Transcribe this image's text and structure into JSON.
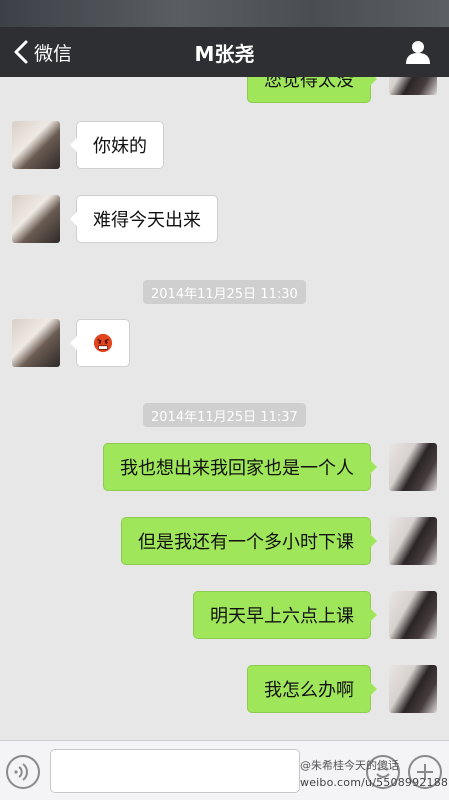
{
  "nav": {
    "back_label": "微信",
    "title": "M张尧"
  },
  "messages": [
    {
      "side": "right",
      "text": "您觉得太没"
    },
    {
      "side": "left",
      "text": "你妹的"
    },
    {
      "side": "left",
      "text": "难得今天出来"
    },
    {
      "timestamp": "2014年11月25日 11:30"
    },
    {
      "side": "left",
      "emoji": "angry-face"
    },
    {
      "timestamp": "2014年11月25日 11:37"
    },
    {
      "side": "right",
      "text": "我也想出来我回家也是一个人"
    },
    {
      "side": "right",
      "text": "但是我还有一个多小时下课"
    },
    {
      "side": "right",
      "text": "明天早上六点上课"
    },
    {
      "side": "right",
      "text": "我怎么办啊"
    }
  ],
  "watermark": {
    "line1": "@朱希桂今天的傻话",
    "line2": "weibo.com/u/5508992188"
  },
  "colors": {
    "nav_bg": "#2d2f33",
    "chat_bg": "#e7e7e7",
    "bubble_right": "#a0e65a",
    "bubble_left": "#ffffff",
    "timestamp_bg": "#cfcfcf"
  }
}
